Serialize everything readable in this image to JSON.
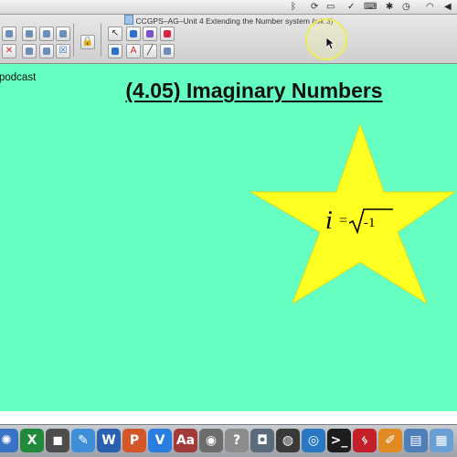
{
  "menubar": {
    "status_icons": [
      {
        "name": "bluetooth-icon",
        "glyph": "ᛒ"
      },
      {
        "name": "sync-icon",
        "glyph": "⟳"
      },
      {
        "name": "display-icon",
        "glyph": "▭"
      },
      {
        "name": "checkbox-icon",
        "glyph": "✓"
      },
      {
        "name": "keyboard-icon",
        "glyph": "⌨"
      },
      {
        "name": "bluetooth-status-icon",
        "glyph": "✱"
      },
      {
        "name": "time-machine-icon",
        "glyph": "◷"
      },
      {
        "name": "wifi-icon",
        "glyph": "◠"
      },
      {
        "name": "volume-icon",
        "glyph": "◀"
      }
    ]
  },
  "window": {
    "title": "CCGPS–AG–Unit 4 Extending the Number system (wk 3)"
  },
  "toolbar": {
    "icons": [
      "new-page-icon",
      "insert-page-icon",
      "copy-page-icon",
      "capture-icon",
      "delete-icon",
      "screen-icon",
      "table-icon",
      "close-icon",
      "lock-icon",
      "select-arrow-icon",
      "pen-icon",
      "highlighter-icon",
      "fill-icon",
      "creative-pen-icon",
      "text-icon",
      "line-icon",
      "eraser-icon"
    ],
    "glyphs": {
      "delete": "✕",
      "close": "☒",
      "text": "A",
      "select": "↖",
      "line": "╱",
      "lock": "🔒"
    }
  },
  "canvas": {
    "background": "#66ffc2",
    "podcast_label": "podcast",
    "heading": "(4.05) Imaginary Numbers",
    "star": {
      "color": "#ffff22",
      "formula": {
        "variable": "i",
        "equals": "=",
        "radicand": "-1"
      }
    }
  },
  "dock": {
    "apps": [
      {
        "name": "dock-safari-icon",
        "glyph": "✺",
        "color": "#3a73c4"
      },
      {
        "name": "dock-excel-icon",
        "glyph": "X",
        "color": "#1f8a3a"
      },
      {
        "name": "dock-facetime-icon",
        "glyph": "◼",
        "color": "#4d4d4d"
      },
      {
        "name": "dock-textedit-icon",
        "glyph": "✎",
        "color": "#3f8fd8"
      },
      {
        "name": "dock-word-icon",
        "glyph": "W",
        "color": "#2b5faf"
      },
      {
        "name": "dock-powerpoint-icon",
        "glyph": "P",
        "color": "#d4572a"
      },
      {
        "name": "dock-smartboard-icon",
        "glyph": "V",
        "color": "#2a7de1"
      },
      {
        "name": "dock-dictionary-icon",
        "glyph": "Aa",
        "color": "#a33a3a"
      },
      {
        "name": "dock-photo-booth-icon",
        "glyph": "◉",
        "color": "#6d6d6d"
      },
      {
        "name": "dock-help-icon",
        "glyph": "?",
        "color": "#8c8c8c"
      },
      {
        "name": "dock-camera-icon",
        "glyph": "◘",
        "color": "#5a6b7c"
      },
      {
        "name": "dock-podcast-icon",
        "glyph": "◍",
        "color": "#3a3a3a"
      },
      {
        "name": "dock-dvd-icon",
        "glyph": "◎",
        "color": "#2a78c4"
      },
      {
        "name": "dock-terminal-icon",
        "glyph": ">_",
        "color": "#1d1d1d"
      },
      {
        "name": "dock-acrobat-icon",
        "glyph": "ᛃ",
        "color": "#c4202a"
      },
      {
        "name": "dock-pages-icon",
        "glyph": "✐",
        "color": "#e08a24"
      },
      {
        "name": "dock-preview-icon",
        "glyph": "▤",
        "color": "#4f7fb8"
      },
      {
        "name": "dock-folder-icon",
        "glyph": "▦",
        "color": "#6a9fd6"
      }
    ]
  }
}
